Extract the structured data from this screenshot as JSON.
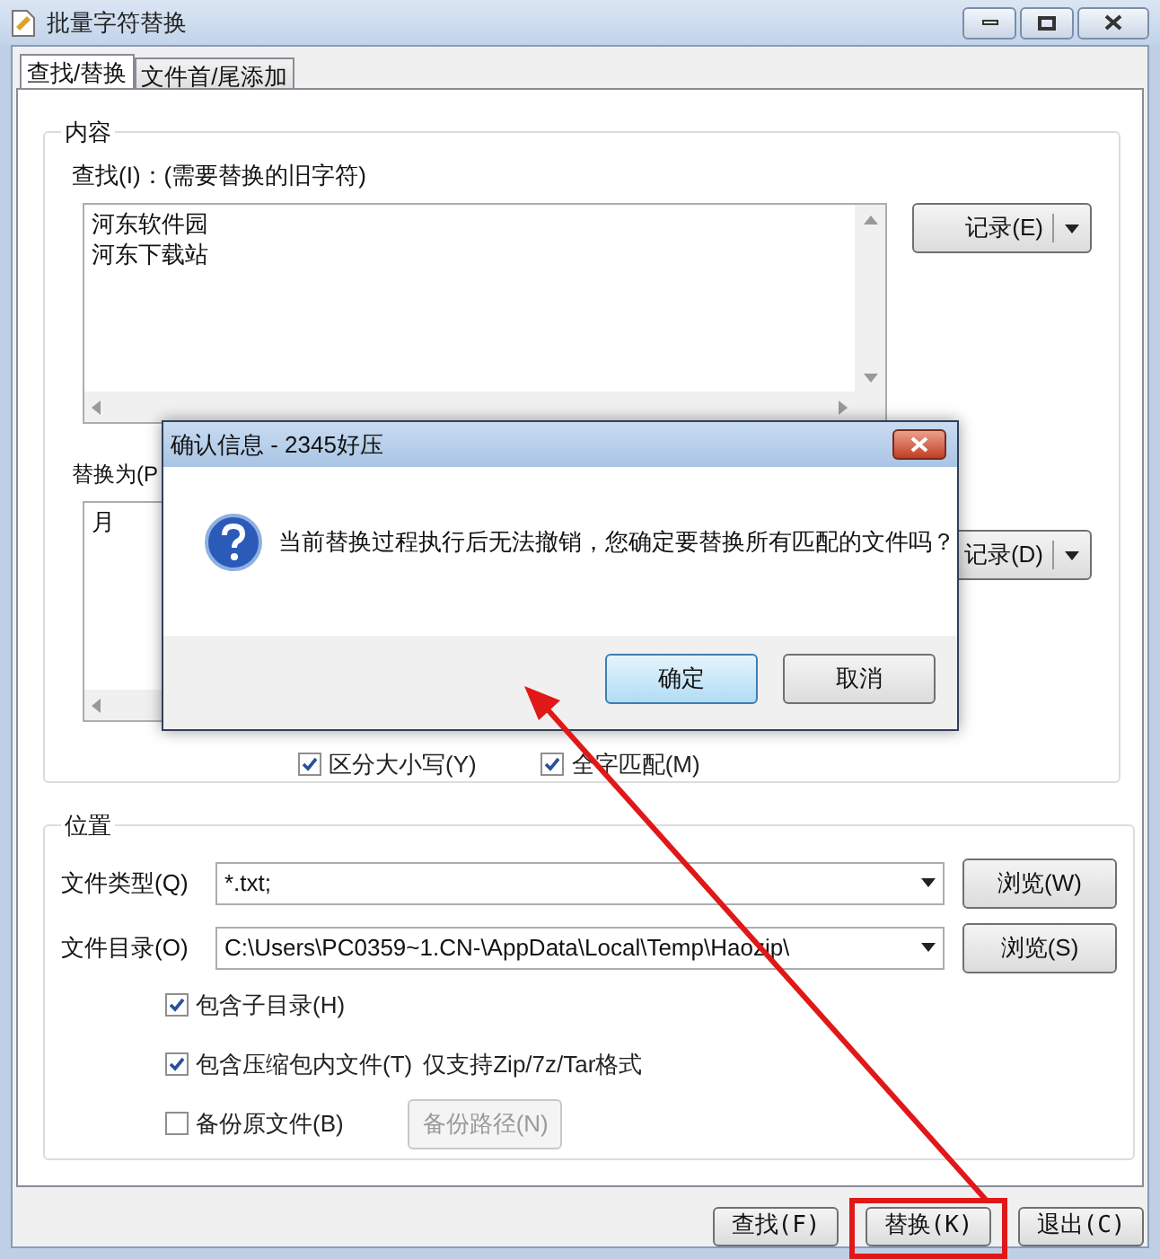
{
  "window": {
    "title": "批量字符替换"
  },
  "tabs": [
    {
      "label": "查找/替换",
      "selected": true
    },
    {
      "label": "文件首/尾添加",
      "selected": false
    }
  ],
  "content_group": {
    "label": "内容",
    "find": {
      "label": "查找(I)：(需要替换的旧字符)",
      "lines": [
        "河东软件园",
        "河东下载站"
      ],
      "history_button": "记录(E)"
    },
    "replace": {
      "label": "替换为(P",
      "lines": [
        "月"
      ],
      "history_button": "记录(D)"
    },
    "options": [
      {
        "label": "区分大小写(Y)",
        "checked": true
      },
      {
        "label": "全字匹配(M)",
        "checked": true
      }
    ]
  },
  "location_group": {
    "label": "位置",
    "fields": [
      {
        "label": "文件类型(Q)",
        "value": "*.txt;",
        "browse_button": "浏览(W)"
      },
      {
        "label": "文件目录(O)",
        "value": "C:\\Users\\PC0359~1.CN-\\AppData\\Local\\Temp\\Haozip\\",
        "browse_button": "浏览(S)"
      }
    ],
    "options": [
      {
        "label": "包含子目录(H)",
        "checked": true
      },
      {
        "label": "包含压缩包内文件(T)",
        "checked": true,
        "note": "仅支持Zip/7z/Tar格式"
      },
      {
        "label": "备份原文件(B)",
        "checked": false,
        "button": {
          "label": "备份路径(N)",
          "disabled": true
        }
      }
    ]
  },
  "buttons": [
    {
      "label": "查找(F)",
      "highlighted": false
    },
    {
      "label": "替换(K)",
      "highlighted": true
    },
    {
      "label": "退出(C)",
      "highlighted": false
    }
  ],
  "dialog": {
    "title": "确认信息 - 2345好压",
    "message": "当前替换过程执行后无法撤销，您确定要替换所有匹配的文件吗？",
    "buttons": [
      {
        "label": "确定",
        "default": true
      },
      {
        "label": "取消",
        "default": false
      }
    ]
  }
}
